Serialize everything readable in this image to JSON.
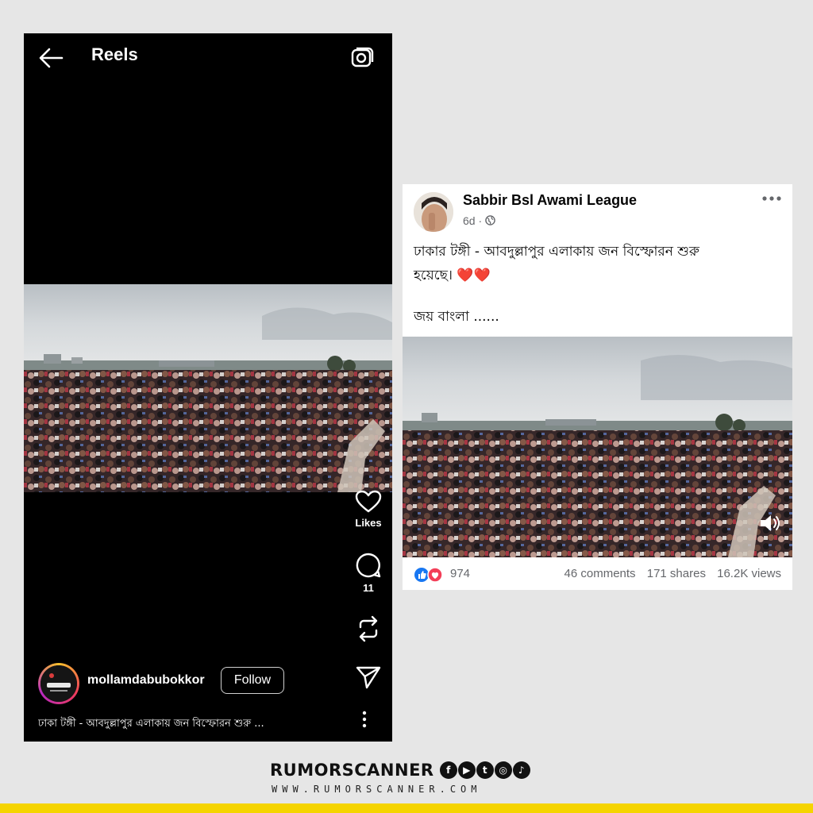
{
  "reels": {
    "title": "Reels",
    "likes_label": "Likes",
    "comments_count": "11",
    "username": "mollamdabubokkor",
    "follow_label": "Follow",
    "caption": "ঢাকা টঙ্গী - আবদুল্লাপুর এলাকায় জন বিস্ফোরন শুরু ...",
    "icons": [
      "back-arrow-icon",
      "camera-icon",
      "heart-icon",
      "comment-icon",
      "repost-icon",
      "send-icon",
      "more-icon"
    ]
  },
  "facebook_post": {
    "author": "Sabbir Bsl Awami League",
    "age": "6d",
    "text_line1": "ঢাকার টঙ্গী - আবদুল্লাপুর এলাকায় জন বিস্ফোরন শুরু",
    "text_line2": "হয়েছে। ❤️❤️",
    "text_line3": "জয় বাংলা ......",
    "reactions_count": "974",
    "comments": "46 comments",
    "shares": "171 shares",
    "views": "16.2K views"
  },
  "brand": {
    "name": "RUMORSCANNER",
    "url": "WWW.RUMORSCANNER.COM",
    "accent_color": "#f5d400"
  }
}
